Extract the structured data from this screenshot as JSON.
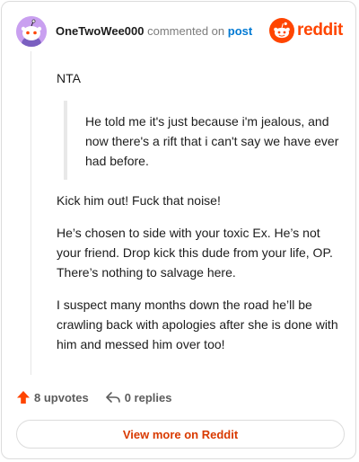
{
  "header": {
    "author": "OneTwoWee000",
    "action": "commented on",
    "post_link": "post",
    "brand": "reddit"
  },
  "comment": {
    "paragraphs_before": [
      "NTA"
    ],
    "quote": "He told me it's just because i'm jealous, and now there's a rift that i can't say we have ever had before.",
    "paragraphs_after": [
      "Kick him out! Fuck that noise!",
      "He’s chosen to side with your toxic Ex. He’s not your friend. Drop kick this dude from your life, OP. There’s nothing to salvage here.",
      "I suspect many months down the road he’ll be crawling back with apologies after she is done with him and messed him over too!"
    ]
  },
  "footer": {
    "upvotes": "8 upvotes",
    "replies": "0 replies",
    "view_more": "View more on Reddit"
  },
  "colors": {
    "brand": "#ff4500",
    "upvote": "#ff4500",
    "link": "#0079d3",
    "view_more_text": "#d93a00",
    "avatar_bg": "#c9a0f0"
  },
  "icons": {
    "upvote": "upvote-arrow-icon",
    "reply": "reply-arrow-icon",
    "logo": "reddit-logo-icon"
  }
}
